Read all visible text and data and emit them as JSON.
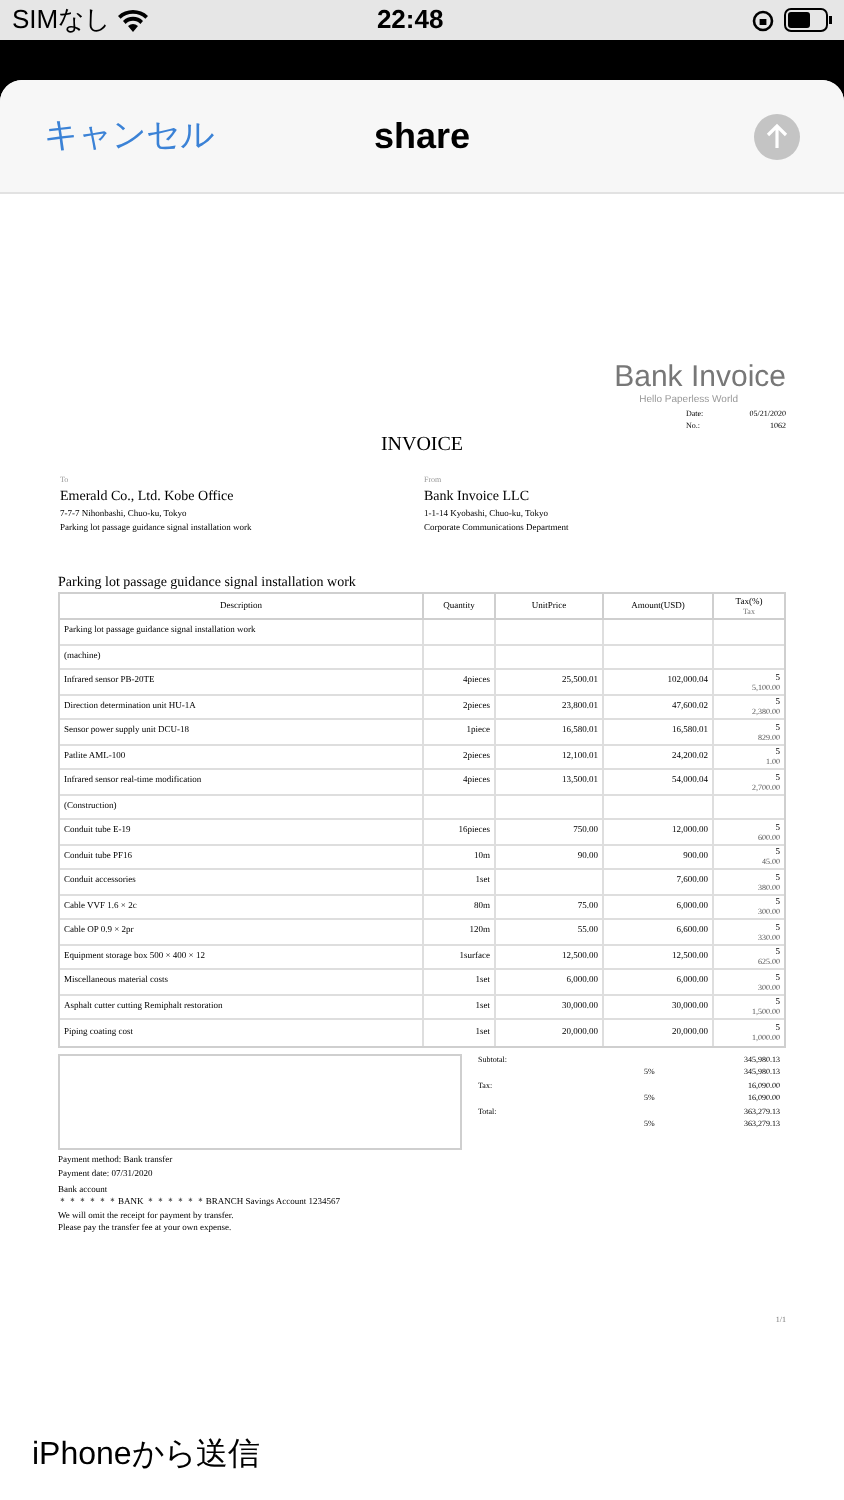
{
  "status_bar": {
    "carrier": "SIMなし",
    "time": "22:48"
  },
  "nav": {
    "cancel": "キャンセル",
    "title": "share",
    "send_disabled": true
  },
  "invoice": {
    "brand": "Bank Invoice",
    "tagline": "Hello Paperless World",
    "meta": [
      {
        "label": "Date:",
        "value": "05/21/2020"
      },
      {
        "label": "No.:",
        "value": "1062"
      }
    ],
    "title": "INVOICE",
    "parties": [
      {
        "label": "To",
        "name": "Emerald Co., Ltd. Kobe Office",
        "lines": [
          "7-7-7 Nihonbashi, Chuo-ku, Tokyo",
          "Parking lot passage guidance signal installation work"
        ]
      },
      {
        "label": "From",
        "name": "Bank Invoice LLC",
        "lines": [
          "1-1-14 Kyobashi, Chuo-ku, Tokyo",
          "Corporate Communications Department"
        ]
      }
    ],
    "subject": "Parking lot passage guidance signal installation work",
    "columns": [
      {
        "label": "Description"
      },
      {
        "label": "Quantity"
      },
      {
        "label": "UnitPrice"
      },
      {
        "label": "Amount(USD)"
      },
      {
        "label": "Tax(%)",
        "sub": "Tax"
      }
    ],
    "rows": [
      {
        "kind": "section",
        "description": "Parking lot passage guidance signal installation work"
      },
      {
        "kind": "section",
        "description": "(machine)"
      },
      {
        "kind": "item",
        "description": "Infrared sensor PB-20TE",
        "quantity": "4pieces",
        "unit_price": "25,500.01",
        "amount": "102,000.04",
        "tax_rate": "5",
        "tax": "5,100.00"
      },
      {
        "kind": "item",
        "description": "Direction determination unit HU-1A",
        "quantity": "2pieces",
        "unit_price": "23,800.01",
        "amount": "47,600.02",
        "tax_rate": "5",
        "tax": "2,380.00"
      },
      {
        "kind": "item",
        "description": "Sensor power supply unit DCU-18",
        "quantity": "1piece",
        "unit_price": "16,580.01",
        "amount": "16,580.01",
        "tax_rate": "5",
        "tax": "829.00"
      },
      {
        "kind": "item",
        "description": "Patlite AML-100",
        "quantity": "2pieces",
        "unit_price": "12,100.01",
        "amount": "24,200.02",
        "tax_rate": "5",
        "tax": "1.00"
      },
      {
        "kind": "item",
        "description": "Infrared sensor real-time modification",
        "quantity": "4pieces",
        "unit_price": "13,500.01",
        "amount": "54,000.04",
        "tax_rate": "5",
        "tax": "2,700.00"
      },
      {
        "kind": "section",
        "description": "(Construction)"
      },
      {
        "kind": "item",
        "description": "Conduit tube E-19",
        "quantity": "16pieces",
        "unit_price": "750.00",
        "amount": "12,000.00",
        "tax_rate": "5",
        "tax": "600.00"
      },
      {
        "kind": "item",
        "description": "Conduit tube PF16",
        "quantity": "10m",
        "unit_price": "90.00",
        "amount": "900.00",
        "tax_rate": "5",
        "tax": "45.00"
      },
      {
        "kind": "item",
        "description": "Conduit accessories",
        "quantity": "1set",
        "amount": "7,600.00",
        "tax_rate": "5",
        "tax": "380.00"
      },
      {
        "kind": "item",
        "description": "Cable VVF 1.6 × 2c",
        "quantity": "80m",
        "unit_price": "75.00",
        "amount": "6,000.00",
        "tax_rate": "5",
        "tax": "300.00"
      },
      {
        "kind": "item",
        "description": "Cable OP 0.9 × 2pr",
        "quantity": "120m",
        "unit_price": "55.00",
        "amount": "6,600.00",
        "tax_rate": "5",
        "tax": "330.00"
      },
      {
        "kind": "item",
        "description": "Equipment storage box 500 × 400 × 12",
        "quantity": "1surface",
        "unit_price": "12,500.00",
        "amount": "12,500.00",
        "tax_rate": "5",
        "tax": "625.00"
      },
      {
        "kind": "item",
        "description": "Miscellaneous material costs",
        "quantity": "1set",
        "unit_price": "6,000.00",
        "amount": "6,000.00",
        "tax_rate": "5",
        "tax": "300.00"
      },
      {
        "kind": "item",
        "description": "Asphalt cutter cutting Remiphalt restoration",
        "quantity": "1set",
        "unit_price": "30,000.00",
        "amount": "30,000.00",
        "tax_rate": "5",
        "tax": "1,500.00"
      },
      {
        "kind": "item",
        "description": "Piping coating cost",
        "quantity": "1set",
        "unit_price": "20,000.00",
        "amount": "20,000.00",
        "tax_rate": "5",
        "tax": "1,000.00"
      }
    ],
    "totals": [
      {
        "label": "Subtotal:",
        "value": "345,980.13",
        "rate": "5%",
        "rate_value": "345,980.13"
      },
      {
        "label": "Tax:",
        "value": "16,090.00",
        "rate": "5%",
        "rate_value": "16,090.00"
      },
      {
        "label": "Total:",
        "value": "363,279.13",
        "rate": "5%",
        "rate_value": "363,279.13"
      }
    ],
    "payment": [
      "Payment method: Bank transfer",
      "Payment date: 07/31/2020",
      "Bank account",
      "＊＊＊＊＊＊BANK ＊＊＊＊＊＊BRANCH Savings Account 1234567",
      "We will omit the receipt for payment by transfer.",
      "Please pay the transfer fee at your own expense."
    ],
    "page": "1/1"
  },
  "footer": "iPhoneから送信"
}
